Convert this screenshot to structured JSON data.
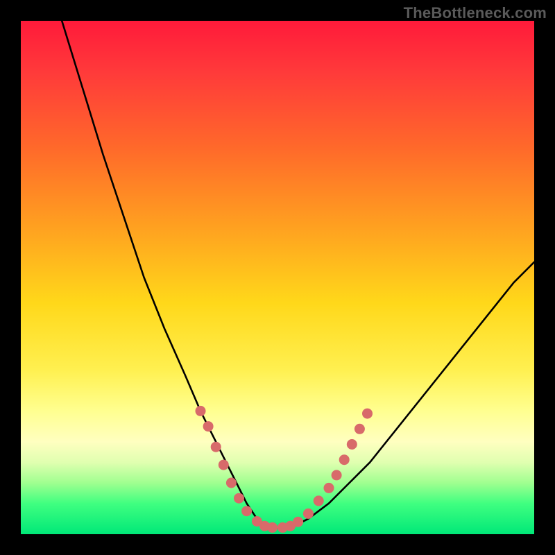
{
  "watermark": "TheBottleneck.com",
  "chart_data": {
    "type": "line",
    "title": "",
    "xlabel": "",
    "ylabel": "",
    "xlim": [
      0,
      100
    ],
    "ylim": [
      0,
      100
    ],
    "background_gradient": {
      "top": "#ff1a3a",
      "upper_mid": "#ffa020",
      "mid": "#fff050",
      "lower_mid": "#ffffc0",
      "bottom": "#00e878"
    },
    "series": [
      {
        "name": "bottleneck-curve",
        "color": "#000000",
        "x": [
          8,
          12,
          16,
          20,
          24,
          28,
          32,
          35,
          38,
          40,
          42,
          44,
          46,
          48,
          50,
          53,
          56,
          60,
          64,
          68,
          72,
          76,
          80,
          84,
          88,
          92,
          96,
          100
        ],
        "y": [
          100,
          87,
          74,
          62,
          50,
          40,
          31,
          24,
          18,
          14,
          10,
          6,
          3,
          1.5,
          1.2,
          1.5,
          3,
          6,
          10,
          14,
          19,
          24,
          29,
          34,
          39,
          44,
          49,
          53
        ]
      }
    ],
    "markers": {
      "name": "sample-points",
      "color": "#d86a6a",
      "radius": 7,
      "points": [
        {
          "x": 35.0,
          "y": 24.0
        },
        {
          "x": 36.5,
          "y": 21.0
        },
        {
          "x": 38.0,
          "y": 17.0
        },
        {
          "x": 39.5,
          "y": 13.5
        },
        {
          "x": 41.0,
          "y": 10.0
        },
        {
          "x": 42.5,
          "y": 7.0
        },
        {
          "x": 44.0,
          "y": 4.5
        },
        {
          "x": 46.0,
          "y": 2.5
        },
        {
          "x": 47.5,
          "y": 1.6
        },
        {
          "x": 49.0,
          "y": 1.3
        },
        {
          "x": 51.0,
          "y": 1.3
        },
        {
          "x": 52.5,
          "y": 1.6
        },
        {
          "x": 54.0,
          "y": 2.4
        },
        {
          "x": 56.0,
          "y": 4.0
        },
        {
          "x": 58.0,
          "y": 6.5
        },
        {
          "x": 60.0,
          "y": 9.0
        },
        {
          "x": 61.5,
          "y": 11.5
        },
        {
          "x": 63.0,
          "y": 14.5
        },
        {
          "x": 64.5,
          "y": 17.5
        },
        {
          "x": 66.0,
          "y": 20.5
        },
        {
          "x": 67.5,
          "y": 23.5
        }
      ]
    }
  }
}
